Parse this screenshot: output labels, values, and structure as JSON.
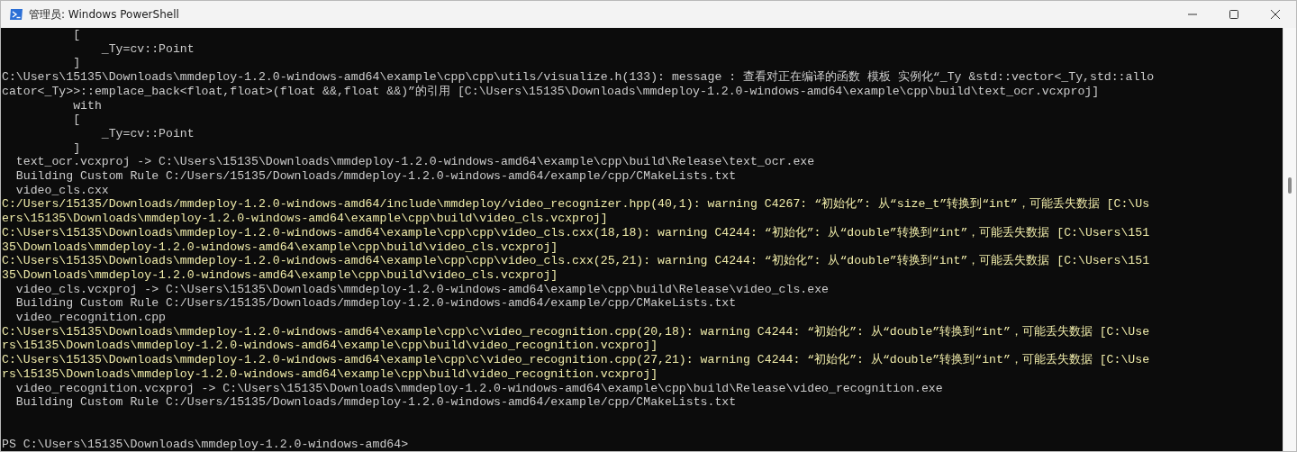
{
  "window": {
    "title": "管理员: Windows PowerShell"
  },
  "console": {
    "lines": [
      {
        "kind": "normal",
        "text": "          ["
      },
      {
        "kind": "normal",
        "text": "              _Ty=cv::Point"
      },
      {
        "kind": "normal",
        "text": "          ]"
      },
      {
        "kind": "normal",
        "text": "C:\\Users\\15135\\Downloads\\mmdeploy-1.2.0-windows-amd64\\example\\cpp\\cpp\\utils/visualize.h(133): message : 查看对正在编译的函数 模板 实例化“_Ty &std::vector<_Ty,std::allo"
      },
      {
        "kind": "normal",
        "text": "cator<_Ty>>::emplace_back<float,float>(float &&,float &&)”的引用 [C:\\Users\\15135\\Downloads\\mmdeploy-1.2.0-windows-amd64\\example\\cpp\\build\\text_ocr.vcxproj]"
      },
      {
        "kind": "normal",
        "text": "          with"
      },
      {
        "kind": "normal",
        "text": "          ["
      },
      {
        "kind": "normal",
        "text": "              _Ty=cv::Point"
      },
      {
        "kind": "normal",
        "text": "          ]"
      },
      {
        "kind": "normal",
        "text": "  text_ocr.vcxproj -> C:\\Users\\15135\\Downloads\\mmdeploy-1.2.0-windows-amd64\\example\\cpp\\build\\Release\\text_ocr.exe"
      },
      {
        "kind": "normal",
        "text": "  Building Custom Rule C:/Users/15135/Downloads/mmdeploy-1.2.0-windows-amd64/example/cpp/CMakeLists.txt"
      },
      {
        "kind": "normal",
        "text": "  video_cls.cxx"
      },
      {
        "kind": "warning",
        "text": "C:/Users/15135/Downloads/mmdeploy-1.2.0-windows-amd64/include\\mmdeploy/video_recognizer.hpp(40,1): warning C4267: “初始化”: 从“size_t”转换到“int”，可能丢失数据 [C:\\Us"
      },
      {
        "kind": "warning",
        "text": "ers\\15135\\Downloads\\mmdeploy-1.2.0-windows-amd64\\example\\cpp\\build\\video_cls.vcxproj]"
      },
      {
        "kind": "warning",
        "text": "C:\\Users\\15135\\Downloads\\mmdeploy-1.2.0-windows-amd64\\example\\cpp\\cpp\\video_cls.cxx(18,18): warning C4244: “初始化”: 从“double”转换到“int”，可能丢失数据 [C:\\Users\\151"
      },
      {
        "kind": "warning",
        "text": "35\\Downloads\\mmdeploy-1.2.0-windows-amd64\\example\\cpp\\build\\video_cls.vcxproj]"
      },
      {
        "kind": "warning",
        "text": "C:\\Users\\15135\\Downloads\\mmdeploy-1.2.0-windows-amd64\\example\\cpp\\cpp\\video_cls.cxx(25,21): warning C4244: “初始化”: 从“double”转换到“int”，可能丢失数据 [C:\\Users\\151"
      },
      {
        "kind": "warning",
        "text": "35\\Downloads\\mmdeploy-1.2.0-windows-amd64\\example\\cpp\\build\\video_cls.vcxproj]"
      },
      {
        "kind": "normal",
        "text": "  video_cls.vcxproj -> C:\\Users\\15135\\Downloads\\mmdeploy-1.2.0-windows-amd64\\example\\cpp\\build\\Release\\video_cls.exe"
      },
      {
        "kind": "normal",
        "text": "  Building Custom Rule C:/Users/15135/Downloads/mmdeploy-1.2.0-windows-amd64/example/cpp/CMakeLists.txt"
      },
      {
        "kind": "normal",
        "text": "  video_recognition.cpp"
      },
      {
        "kind": "warning",
        "text": "C:\\Users\\15135\\Downloads\\mmdeploy-1.2.0-windows-amd64\\example\\cpp\\c\\video_recognition.cpp(20,18): warning C4244: “初始化”: 从“double”转换到“int”，可能丢失数据 [C:\\Use"
      },
      {
        "kind": "warning",
        "text": "rs\\15135\\Downloads\\mmdeploy-1.2.0-windows-amd64\\example\\cpp\\build\\video_recognition.vcxproj]"
      },
      {
        "kind": "warning",
        "text": "C:\\Users\\15135\\Downloads\\mmdeploy-1.2.0-windows-amd64\\example\\cpp\\c\\video_recognition.cpp(27,21): warning C4244: “初始化”: 从“double”转换到“int”，可能丢失数据 [C:\\Use"
      },
      {
        "kind": "warning",
        "text": "rs\\15135\\Downloads\\mmdeploy-1.2.0-windows-amd64\\example\\cpp\\build\\video_recognition.vcxproj]"
      },
      {
        "kind": "normal",
        "text": "  video_recognition.vcxproj -> C:\\Users\\15135\\Downloads\\mmdeploy-1.2.0-windows-amd64\\example\\cpp\\build\\Release\\video_recognition.exe"
      },
      {
        "kind": "normal",
        "text": "  Building Custom Rule C:/Users/15135/Downloads/mmdeploy-1.2.0-windows-amd64/example/cpp/CMakeLists.txt"
      }
    ],
    "prompt": "PS C:\\Users\\15135\\Downloads\\mmdeploy-1.2.0-windows-amd64>"
  }
}
